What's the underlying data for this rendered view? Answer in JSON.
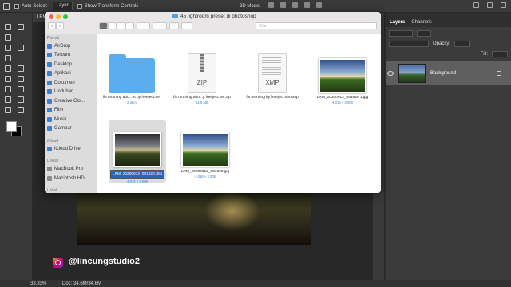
{
  "photoshop": {
    "options_bar": {
      "auto_select_label": "Auto-Select:",
      "auto_select_value": "Layer",
      "transform_label": "Show Transform Controls",
      "mode_label": "3D Mode:"
    },
    "doc_tab": "LRM",
    "status": {
      "zoom": "33,33%",
      "doc_size": "Doc: 34,6M/34,6M"
    },
    "layers_panel": {
      "tabs": [
        "Layers",
        "Channels"
      ],
      "opacity_label": "Opacity:",
      "fill_label": "Fill:",
      "layer_name": "Background"
    }
  },
  "finder": {
    "title": "45 lightroom preset di photoshop",
    "search_placeholder": "Cari",
    "sidebar": {
      "favorites_header": "Favorit",
      "favorites": [
        "AirDrop",
        "Terbaru",
        "Desktop",
        "Aplikasi",
        "Dokumen",
        "Unduhan",
        "Creative Clo...",
        "Film",
        "Musik",
        "Gambar"
      ],
      "icloud_header": "iCloud",
      "icloud": [
        "iCloud Drive"
      ],
      "locations_header": "Lokasi",
      "locations": [
        "MacBook Pro",
        "Macintosh HD"
      ],
      "tags_header": "Label"
    },
    "files": [
      {
        "name": "fis morning ado...et by freeject.net",
        "meta": "2 item",
        "kind": "folder"
      },
      {
        "name": "fis morning ado...y freeject.net.zip",
        "meta": "51,6 MB",
        "kind": "zip",
        "label": "ZIP"
      },
      {
        "name": "fis morning by freeject.net.xmp",
        "meta": "",
        "kind": "xmp",
        "label": "XMP"
      },
      {
        "name": "LRM_20200912_081820 1.jpg",
        "meta": "4.016 × 3.008",
        "kind": "image"
      },
      {
        "name": "LRM_20200912_081820.dng",
        "meta": "4.016 × 3.008",
        "kind": "dng",
        "selected": true
      },
      {
        "name": "LRM_20200912_081820.jpg",
        "meta": "4.016 × 3.008",
        "kind": "image"
      }
    ]
  },
  "watermark": "@lincungstudio2"
}
